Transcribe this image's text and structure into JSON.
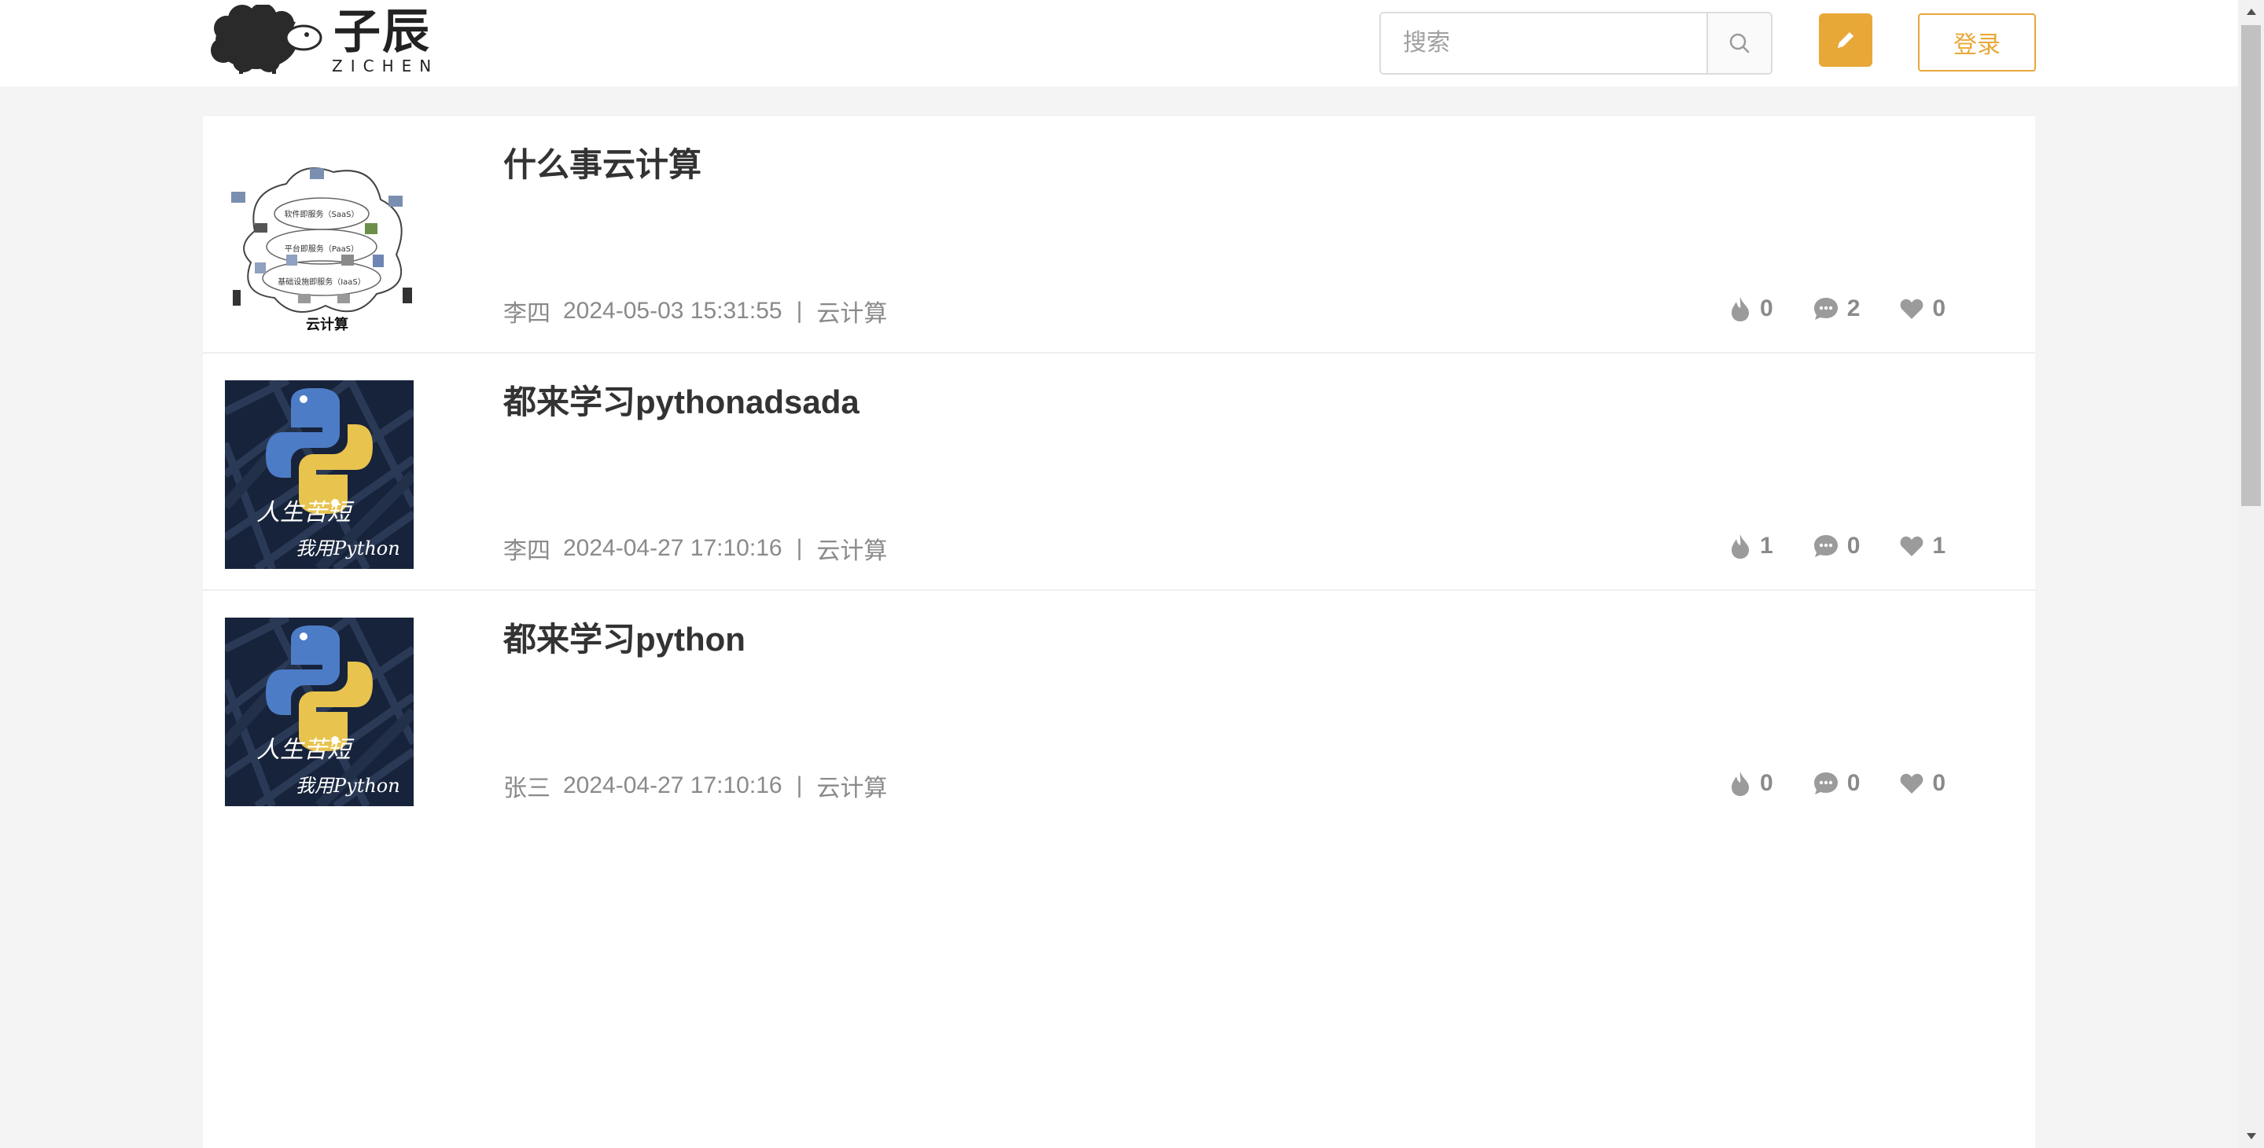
{
  "header": {
    "logo_text": "子辰",
    "logo_sub": "ZICHEN",
    "search_placeholder": "搜索",
    "login_label": "登录"
  },
  "articles": [
    {
      "title": "什么事云计算",
      "author": "李四",
      "date": "2024-05-03 15:31:55",
      "separator": "|",
      "category": "云计算",
      "likes": "0",
      "comments": "2",
      "favorites": "0",
      "thumb": "cloud-diagram",
      "thumb_caption": "云计算",
      "thumb_labels": [
        "软件即服务（SaaS）",
        "平台即服务（PaaS）",
        "基础设施即服务（IaaS）"
      ]
    },
    {
      "title": "都来学习pythonadsada",
      "author": "李四",
      "date": "2024-04-27 17:10:16",
      "separator": "|",
      "category": "云计算",
      "likes": "1",
      "comments": "0",
      "favorites": "1",
      "thumb": "python-poster",
      "thumb_line1": "人生苦短",
      "thumb_line2": "我用Python"
    },
    {
      "title": "都来学习python",
      "author": "张三",
      "date": "2024-04-27 17:10:16",
      "separator": "|",
      "category": "云计算",
      "likes": "0",
      "comments": "0",
      "favorites": "0",
      "thumb": "python-poster",
      "thumb_line1": "人生苦短",
      "thumb_line2": "我用Python"
    }
  ],
  "colors": {
    "accent": "#e8a838",
    "background": "#f4f4f4",
    "meta_text": "#8a8a8a",
    "title_text": "#333333"
  }
}
